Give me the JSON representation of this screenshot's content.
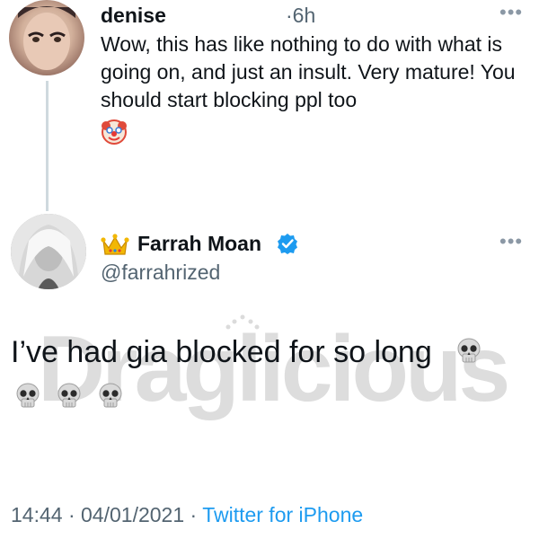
{
  "reply": {
    "name": "denise",
    "time": "6h",
    "text": "Wow, this has like nothing to do with what is going on, and just an insult. Very mature! You should start blocking ppl too",
    "emoji": "clown-face"
  },
  "tweet": {
    "name": "Farrah Moan",
    "handle": "@farrahrized",
    "text": "I’ve had gia blocked for so long",
    "emoji": "skull",
    "verified": true
  },
  "footer": {
    "time": "14:44",
    "date": "04/01/2021",
    "source": "Twitter for iPhone",
    "separator": "·"
  },
  "watermark": {
    "text": "Draglicious"
  },
  "colors": {
    "text": "#0f1419",
    "secondary": "#536471",
    "link": "#1d9bf0",
    "thread_line": "#cfd9de"
  },
  "icons": {
    "more": "more-dots-icon",
    "verified": "verified-badge-icon",
    "crown": "crown-icon",
    "skull": "skull-icon",
    "clown": "clown-icon"
  }
}
